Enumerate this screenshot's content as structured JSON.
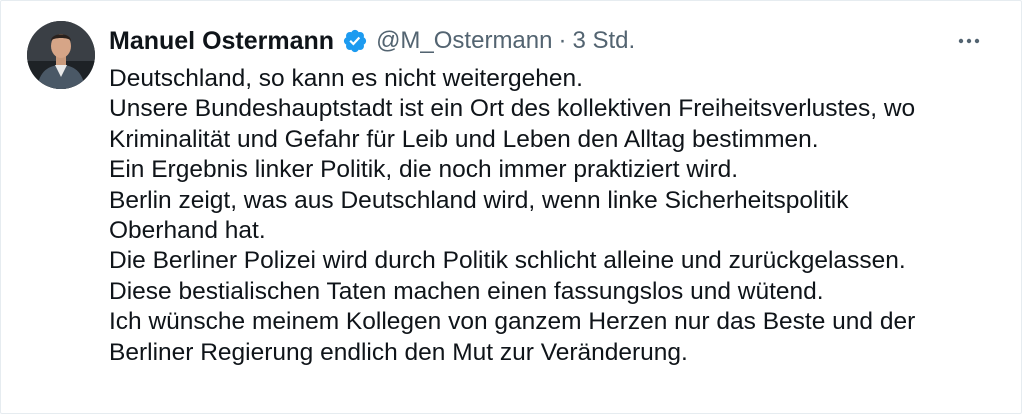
{
  "tweet": {
    "author_name": "Manuel Ostermann",
    "handle": "@M_Ostermann",
    "separator": "·",
    "time": "3 Std.",
    "lines": [
      "Deutschland, so kann es nicht weitergehen.",
      "Unsere Bundeshauptstadt ist ein Ort des kollektiven Freiheitsverlustes, wo",
      "Kriminalität und Gefahr für Leib und Leben den Alltag bestimmen.",
      "Ein Ergebnis linker Politik, die noch immer praktiziert wird.",
      "Berlin zeigt, was aus Deutschland wird, wenn linke Sicherheitspolitik",
      "Oberhand hat.",
      "Die Berliner Polizei wird durch Politik schlicht alleine und zurückgelassen.",
      "Diese bestialischen Taten machen einen fassungslos und wütend.",
      "Ich wünsche meinem Kollegen von ganzem Herzen nur das Beste und der",
      "Berliner Regierung endlich den Mut zur Veränderung."
    ]
  },
  "icons": {
    "verified": "verified-badge-icon",
    "more": "more-horizontal-icon"
  },
  "colors": {
    "text": "#0f1419",
    "secondary": "#536471",
    "verified": "#1d9bf0",
    "border": "#e6ecf0"
  }
}
